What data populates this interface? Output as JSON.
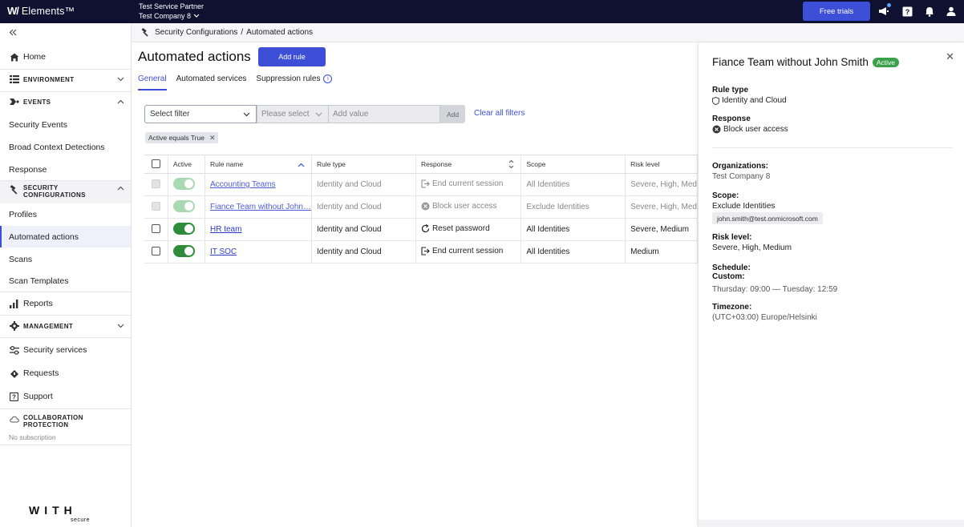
{
  "topbar": {
    "brand": "Elements™",
    "brand_mark": "W/",
    "partner_label": "Test Service Partner",
    "company": "Test Company 8",
    "free_trials": "Free trials"
  },
  "breadcrumb": {
    "parent": "Security Configurations",
    "separator": "/",
    "current": "Automated actions"
  },
  "sidebar": {
    "home": "Home",
    "environment": "ENVIRONMENT",
    "events": "EVENTS",
    "security_events": "Security Events",
    "broad_context": "Broad Context Detections",
    "response": "Response",
    "security_config_1": "SECURITY",
    "security_config_2": "CONFIGURATIONS",
    "profiles": "Profiles",
    "automated_actions": "Automated actions",
    "scans": "Scans",
    "scan_templates": "Scan Templates",
    "reports": "Reports",
    "management": "MANAGEMENT",
    "security_services": "Security services",
    "requests": "Requests",
    "support": "Support",
    "collab_1": "COLLABORATION",
    "collab_2": "PROTECTION",
    "no_subscription": "No subscription",
    "logo_with": "WITH",
    "logo_secure": "secure"
  },
  "main": {
    "title": "Automated actions",
    "add_rule": "Add rule",
    "tabs": [
      "General",
      "Automated services",
      "Suppression rules"
    ],
    "filter": {
      "select_placeholder": "Select filter",
      "please_select": "Please select",
      "value_placeholder": "Add value",
      "add": "Add",
      "clear": "Clear all filters",
      "active_chip": "Active equals True"
    },
    "table": {
      "headers": [
        "Active",
        "Rule name",
        "Rule type",
        "Response",
        "Scope",
        "Risk level"
      ],
      "rows": [
        {
          "name": "Accounting Teams",
          "type": "Identity and Cloud",
          "response": "End current session",
          "scope": "All Identities",
          "risk": "Severe, High, Med"
        },
        {
          "name": "Fiance Team without John…",
          "type": "Identity and Cloud",
          "response": "Block user access",
          "scope": "Exclude Identities",
          "risk": "Severe, High, Med"
        },
        {
          "name": "HR team",
          "type": "Identity and Cloud",
          "response": "Reset password",
          "scope": "All Identities",
          "risk": "Severe, Medium"
        },
        {
          "name": "IT SOC",
          "type": "Identity and Cloud",
          "response": "End current session",
          "scope": "All Identities",
          "risk": "Medium"
        }
      ]
    }
  },
  "panel": {
    "title": "Fiance Team without John Smith",
    "badge": "Active",
    "rule_type_label": "Rule type",
    "rule_type": "Identity and Cloud",
    "response_label": "Response",
    "response": "Block user access",
    "organizations_label": "Organizations:",
    "organizations": "Test Company 8",
    "scope_label": "Scope:",
    "scope": "Exclude Identities",
    "scope_email": "john.smith@test.onmicrosoft.com",
    "risk_label": "Risk level:",
    "risk": "Severe, High, Medium",
    "schedule_label": "Schedule:",
    "custom_label": "Custom:",
    "schedule": "Thursday: 09:00 — Tuesday: 12:59",
    "timezone_label": "Timezone:",
    "timezone": "(UTC+03:00) Europe/Helsinki"
  },
  "colors": {
    "topbar": "#0e1230",
    "accent": "#3d4fd6",
    "active_green": "#2e8b3a"
  }
}
